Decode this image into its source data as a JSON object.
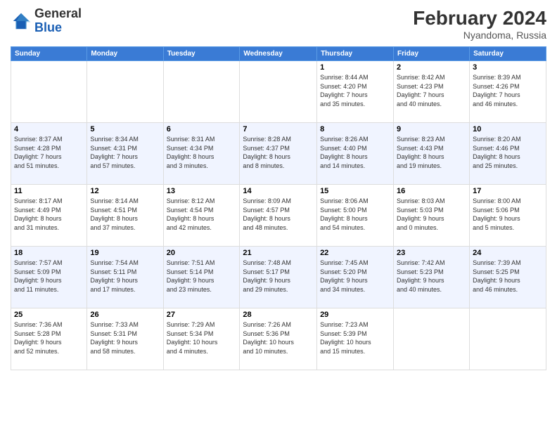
{
  "logo": {
    "general": "General",
    "blue": "Blue"
  },
  "header": {
    "title": "February 2024",
    "location": "Nyandoma, Russia"
  },
  "weekdays": [
    "Sunday",
    "Monday",
    "Tuesday",
    "Wednesday",
    "Thursday",
    "Friday",
    "Saturday"
  ],
  "weeks": [
    [
      {
        "day": "",
        "info": ""
      },
      {
        "day": "",
        "info": ""
      },
      {
        "day": "",
        "info": ""
      },
      {
        "day": "",
        "info": ""
      },
      {
        "day": "1",
        "info": "Sunrise: 8:44 AM\nSunset: 4:20 PM\nDaylight: 7 hours\nand 35 minutes."
      },
      {
        "day": "2",
        "info": "Sunrise: 8:42 AM\nSunset: 4:23 PM\nDaylight: 7 hours\nand 40 minutes."
      },
      {
        "day": "3",
        "info": "Sunrise: 8:39 AM\nSunset: 4:26 PM\nDaylight: 7 hours\nand 46 minutes."
      }
    ],
    [
      {
        "day": "4",
        "info": "Sunrise: 8:37 AM\nSunset: 4:28 PM\nDaylight: 7 hours\nand 51 minutes."
      },
      {
        "day": "5",
        "info": "Sunrise: 8:34 AM\nSunset: 4:31 PM\nDaylight: 7 hours\nand 57 minutes."
      },
      {
        "day": "6",
        "info": "Sunrise: 8:31 AM\nSunset: 4:34 PM\nDaylight: 8 hours\nand 3 minutes."
      },
      {
        "day": "7",
        "info": "Sunrise: 8:28 AM\nSunset: 4:37 PM\nDaylight: 8 hours\nand 8 minutes."
      },
      {
        "day": "8",
        "info": "Sunrise: 8:26 AM\nSunset: 4:40 PM\nDaylight: 8 hours\nand 14 minutes."
      },
      {
        "day": "9",
        "info": "Sunrise: 8:23 AM\nSunset: 4:43 PM\nDaylight: 8 hours\nand 19 minutes."
      },
      {
        "day": "10",
        "info": "Sunrise: 8:20 AM\nSunset: 4:46 PM\nDaylight: 8 hours\nand 25 minutes."
      }
    ],
    [
      {
        "day": "11",
        "info": "Sunrise: 8:17 AM\nSunset: 4:49 PM\nDaylight: 8 hours\nand 31 minutes."
      },
      {
        "day": "12",
        "info": "Sunrise: 8:14 AM\nSunset: 4:51 PM\nDaylight: 8 hours\nand 37 minutes."
      },
      {
        "day": "13",
        "info": "Sunrise: 8:12 AM\nSunset: 4:54 PM\nDaylight: 8 hours\nand 42 minutes."
      },
      {
        "day": "14",
        "info": "Sunrise: 8:09 AM\nSunset: 4:57 PM\nDaylight: 8 hours\nand 48 minutes."
      },
      {
        "day": "15",
        "info": "Sunrise: 8:06 AM\nSunset: 5:00 PM\nDaylight: 8 hours\nand 54 minutes."
      },
      {
        "day": "16",
        "info": "Sunrise: 8:03 AM\nSunset: 5:03 PM\nDaylight: 9 hours\nand 0 minutes."
      },
      {
        "day": "17",
        "info": "Sunrise: 8:00 AM\nSunset: 5:06 PM\nDaylight: 9 hours\nand 5 minutes."
      }
    ],
    [
      {
        "day": "18",
        "info": "Sunrise: 7:57 AM\nSunset: 5:09 PM\nDaylight: 9 hours\nand 11 minutes."
      },
      {
        "day": "19",
        "info": "Sunrise: 7:54 AM\nSunset: 5:11 PM\nDaylight: 9 hours\nand 17 minutes."
      },
      {
        "day": "20",
        "info": "Sunrise: 7:51 AM\nSunset: 5:14 PM\nDaylight: 9 hours\nand 23 minutes."
      },
      {
        "day": "21",
        "info": "Sunrise: 7:48 AM\nSunset: 5:17 PM\nDaylight: 9 hours\nand 29 minutes."
      },
      {
        "day": "22",
        "info": "Sunrise: 7:45 AM\nSunset: 5:20 PM\nDaylight: 9 hours\nand 34 minutes."
      },
      {
        "day": "23",
        "info": "Sunrise: 7:42 AM\nSunset: 5:23 PM\nDaylight: 9 hours\nand 40 minutes."
      },
      {
        "day": "24",
        "info": "Sunrise: 7:39 AM\nSunset: 5:25 PM\nDaylight: 9 hours\nand 46 minutes."
      }
    ],
    [
      {
        "day": "25",
        "info": "Sunrise: 7:36 AM\nSunset: 5:28 PM\nDaylight: 9 hours\nand 52 minutes."
      },
      {
        "day": "26",
        "info": "Sunrise: 7:33 AM\nSunset: 5:31 PM\nDaylight: 9 hours\nand 58 minutes."
      },
      {
        "day": "27",
        "info": "Sunrise: 7:29 AM\nSunset: 5:34 PM\nDaylight: 10 hours\nand 4 minutes."
      },
      {
        "day": "28",
        "info": "Sunrise: 7:26 AM\nSunset: 5:36 PM\nDaylight: 10 hours\nand 10 minutes."
      },
      {
        "day": "29",
        "info": "Sunrise: 7:23 AM\nSunset: 5:39 PM\nDaylight: 10 hours\nand 15 minutes."
      },
      {
        "day": "",
        "info": ""
      },
      {
        "day": "",
        "info": ""
      }
    ]
  ]
}
